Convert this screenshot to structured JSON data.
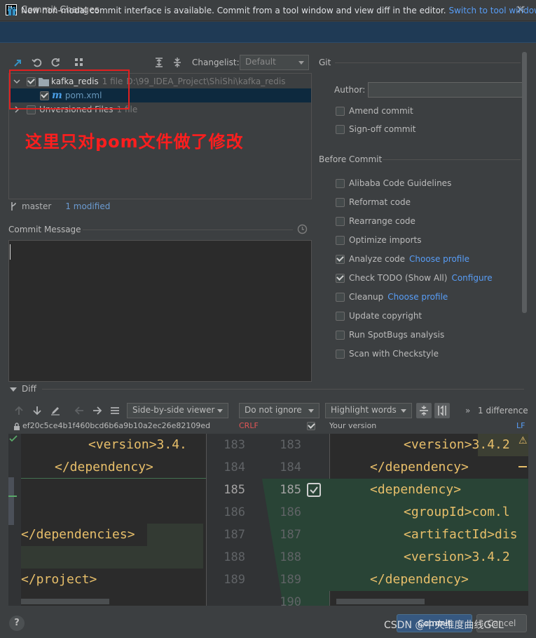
{
  "window": {
    "title": "Commit Changes",
    "logo": "IJ"
  },
  "banner": {
    "text": "New non-modal commit interface is available. Commit from a tool window and view diff in the editor.",
    "link": "Switch to tool window"
  },
  "toolbar": {
    "changelist_label": "Changelist:",
    "changelist_value": "Default"
  },
  "tree": {
    "module": {
      "name": "kafka_redis",
      "count": "1 file",
      "path": "D:\\99_IDEA_Project\\ShiShi\\kafka_redis"
    },
    "file": {
      "name": "pom.xml"
    },
    "unversioned": {
      "name": "Unversioned Files",
      "count": "1 file"
    }
  },
  "annotation": "这里只对pom文件做了修改",
  "branch": {
    "name": "master",
    "status": "1 modified"
  },
  "commit_message": {
    "label": "Commit Message"
  },
  "git": {
    "section": "Git",
    "author_label": "Author:",
    "amend": "Amend commit",
    "signoff": "Sign-off commit"
  },
  "before_commit": {
    "section": "Before Commit",
    "options": [
      {
        "label": "Alibaba Code Guidelines",
        "checked": false,
        "link": ""
      },
      {
        "label": "Reformat code",
        "checked": false,
        "link": ""
      },
      {
        "label": "Rearrange code",
        "checked": false,
        "link": ""
      },
      {
        "label": "Optimize imports",
        "checked": false,
        "link": ""
      },
      {
        "label": "Analyze code",
        "checked": true,
        "link": "Choose profile"
      },
      {
        "label": "Check TODO (Show All)",
        "checked": true,
        "link": "Configure"
      },
      {
        "label": "Cleanup",
        "checked": false,
        "link": "Choose profile"
      },
      {
        "label": "Update copyright",
        "checked": false,
        "link": ""
      },
      {
        "label": "Run SpotBugs analysis",
        "checked": false,
        "link": ""
      },
      {
        "label": "Scan with Checkstyle",
        "checked": false,
        "link": ""
      }
    ]
  },
  "diff": {
    "title": "Diff",
    "viewer": "Side-by-side viewer",
    "whitespace": "Do not ignore",
    "highlight": "Highlight words",
    "differences": "1 difference",
    "left_hash": "ef20c5ce4b1f460bcd6b6a9b10a2ec26e82109ed",
    "left_eol": "CRLF",
    "right_label": "Your version",
    "right_eol": "LF",
    "left_lines": [
      "<version>3.4.",
      "</dependency>",
      "",
      "",
      "</dependencies>",
      "",
      "</project>"
    ],
    "right_lines": [
      "<version>3.4.2",
      "</dependency>",
      "<dependency>",
      "<groupId>com.l",
      "<artifactId>dis",
      "<version>3.4.2",
      "</dependency>"
    ],
    "line_numbers_left": [
      "183",
      "184",
      "185",
      "186",
      "187",
      "188",
      "189"
    ],
    "line_numbers_right": [
      "183",
      "184",
      "185",
      "186",
      "187",
      "188",
      "189",
      "190"
    ]
  },
  "buttons": {
    "help": "?",
    "commit": "Commit",
    "cancel": "Cancel"
  },
  "watermark": "CSDN @中央维度曲线GCL"
}
